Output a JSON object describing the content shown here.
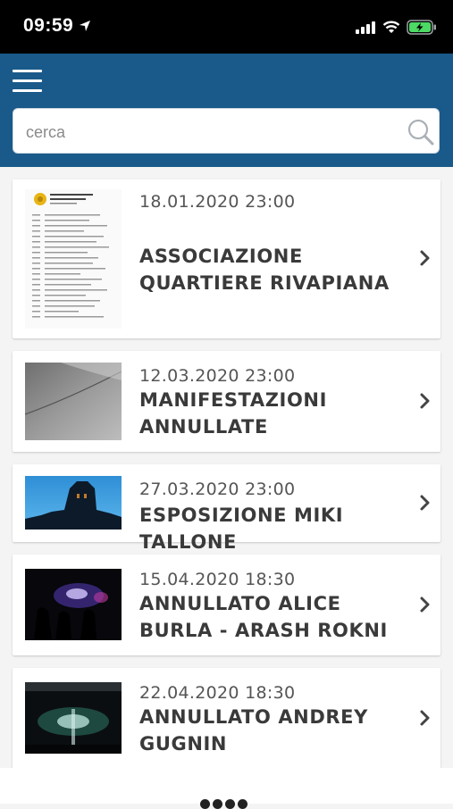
{
  "status": {
    "time": "09:59"
  },
  "search": {
    "placeholder": "cerca"
  },
  "events": [
    {
      "date": "18.01.2020 23:00",
      "title": "ASSOCIAZIONE QUARTIERE RIVAPIANA"
    },
    {
      "date": "12.03.2020 23:00",
      "title": "MANIFESTAZIONI ANNULLATE"
    },
    {
      "date": "27.03.2020 23:00",
      "title": "ESPOSIZIONE MIKI TALLONE"
    },
    {
      "date": "15.04.2020 18:30",
      "title": "ANNULLATO ALICE BURLA - ARASH ROKNI"
    },
    {
      "date": "22.04.2020 18:30",
      "title": "ANNULLATO ANDREY GUGNIN"
    }
  ],
  "colors": {
    "header": "#1a5a8a",
    "background": "#f4f4f4",
    "card": "#ffffff",
    "title_text": "#3a3a3a",
    "battery": "#4cd964"
  },
  "icons": [
    "location-arrow-icon",
    "signal-icon",
    "wifi-icon",
    "battery-icon",
    "menu-icon",
    "search-icon",
    "chevron-right-icon"
  ]
}
